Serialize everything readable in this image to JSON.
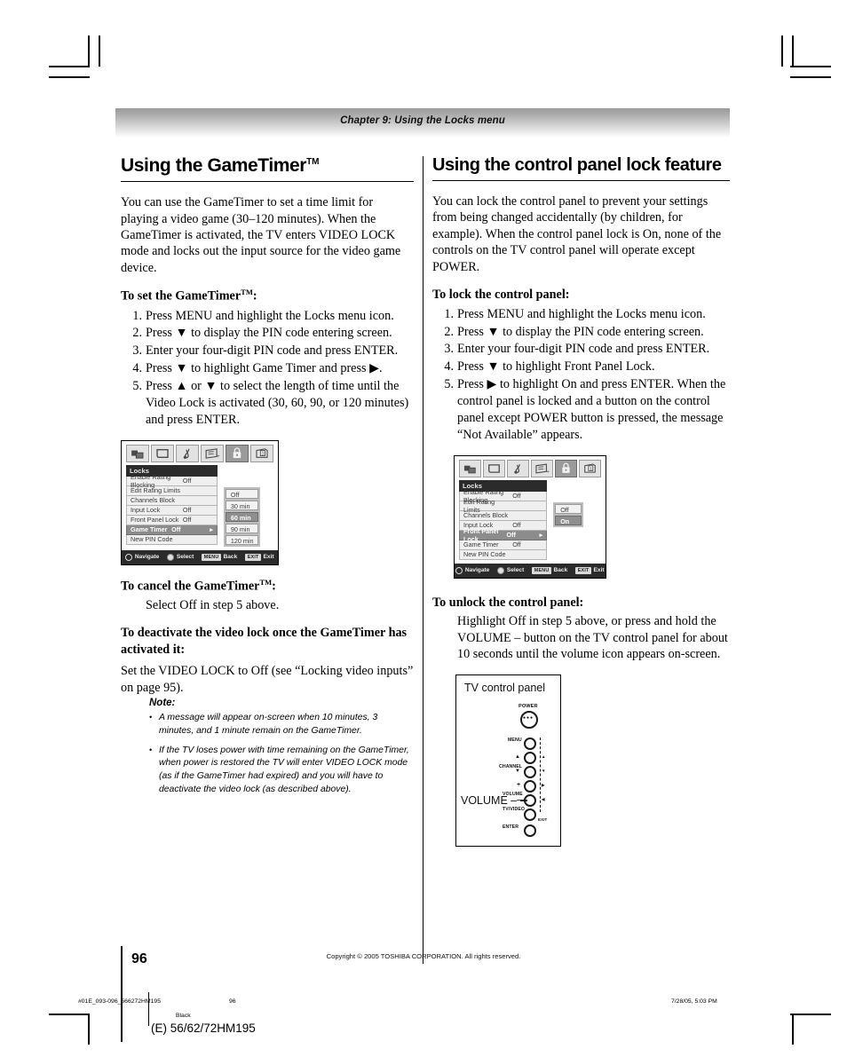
{
  "chapter": {
    "header": "Chapter 9: Using the Locks menu"
  },
  "left_column": {
    "heading": "Using the GameTimer",
    "heading_tm": "TM",
    "intro": "You can use the GameTimer to set a time limit for playing a video game (30–120 minutes). When the GameTimer is activated, the TV enters VIDEO LOCK mode and locks out the input source for the video game device.",
    "set_heading": "To set the GameTimer",
    "set_heading_tm": "TM",
    "set_heading_colon": ":",
    "steps": [
      "Press MENU and highlight the Locks menu icon.",
      "Press ▼ to display the PIN code entering screen.",
      "Enter your four-digit PIN code and press ENTER.",
      "Press ▼ to highlight Game Timer and press ▶.",
      "Press ▲ or ▼ to select the length of time until the Video Lock is activated (30, 60, 90, or 120 minutes) and press ENTER."
    ],
    "cancel_heading": "To cancel the GameTimer",
    "cancel_heading_tm": "TM",
    "cancel_heading_colon": ":",
    "cancel_text": "Select Off in step 5 above.",
    "deactivate_heading": "To deactivate the video lock once the GameTimer has activated it:",
    "deactivate_text": "Set the VIDEO LOCK to Off (see “Locking video inputs” on page 95).",
    "note_label": "Note:",
    "notes": [
      "A message will appear on-screen when 10 minutes, 3 minutes, and 1 minute remain on the GameTimer.",
      "If the TV loses power with time remaining on the GameTimer, when power is restored the TV will enter VIDEO LOCK mode (as if the GameTimer had expired) and you will have to deactivate the video lock (as described above)."
    ]
  },
  "right_column": {
    "heading": "Using the control panel lock feature",
    "intro": "You can lock the control panel to prevent your settings from being changed accidentally (by children, for example). When the control panel lock is On, none of the controls on the TV control panel will operate except POWER.",
    "lock_heading": "To lock the control panel:",
    "steps": [
      "Press MENU and highlight the Locks menu icon.",
      "Press ▼ to display the PIN code entering screen.",
      "Enter your four-digit PIN code and press ENTER.",
      "Press ▼ to highlight Front Panel Lock.",
      "Press ▶ to highlight On and press ENTER. When the control panel is locked and a button on the control panel except POWER button is pressed, the message “Not Available” appears."
    ],
    "unlock_heading": "To unlock the control panel:",
    "unlock_text": "Highlight Off in step 5 above, or press and hold the VOLUME – button on the TV control panel for about 10 seconds until the volume icon appears on-screen."
  },
  "osd_left": {
    "icons": [
      "picture-icon",
      "video-icon",
      "audio-icon",
      "settings-icon",
      "locks-icon",
      "setup-icon"
    ],
    "active_icon_index": 4,
    "title": "Locks",
    "rows": [
      {
        "label": "Enable Rating Blocking",
        "value": "Off",
        "selected": false,
        "arrow": ""
      },
      {
        "label": "Edit Rating Limits",
        "value": "",
        "selected": false,
        "arrow": ""
      },
      {
        "label": "Channels Block",
        "value": "",
        "selected": false,
        "arrow": ""
      },
      {
        "label": "Input Lock",
        "value": "Off",
        "selected": false,
        "arrow": ""
      },
      {
        "label": "Front Panel Lock",
        "value": "Off",
        "selected": false,
        "arrow": ""
      },
      {
        "label": "Game Timer",
        "value": "Off",
        "selected": true,
        "arrow": "▸"
      },
      {
        "label": "New PIN Code",
        "value": "",
        "selected": false,
        "arrow": ""
      }
    ],
    "dropdown": [
      {
        "label": "Off",
        "selected": false
      },
      {
        "label": "30 min",
        "selected": false
      },
      {
        "label": "60 min",
        "selected": true
      },
      {
        "label": "90 min",
        "selected": false
      },
      {
        "label": "120 min",
        "selected": false
      }
    ],
    "navbar": [
      {
        "glyph": "ring",
        "label": "Navigate"
      },
      {
        "glyph": "dot",
        "label": "Select"
      },
      {
        "glyph": "key",
        "key": "MENU",
        "label": "Back"
      },
      {
        "glyph": "key",
        "key": "EXIT",
        "label": "Exit"
      }
    ]
  },
  "osd_right": {
    "icons": [
      "picture-icon",
      "video-icon",
      "audio-icon",
      "settings-icon",
      "locks-icon",
      "setup-icon"
    ],
    "active_icon_index": 4,
    "title": "Locks",
    "rows": [
      {
        "label": "Enable Rating Blocking",
        "value": "Off",
        "selected": false,
        "arrow": ""
      },
      {
        "label": "Edit Rating Limits",
        "value": "",
        "selected": false,
        "arrow": ""
      },
      {
        "label": "Channels Block",
        "value": "",
        "selected": false,
        "arrow": ""
      },
      {
        "label": "Input Lock",
        "value": "Off",
        "selected": false,
        "arrow": ""
      },
      {
        "label": "Front Panel Lock",
        "value": "Off",
        "selected": true,
        "arrow": "▸"
      },
      {
        "label": "Game Timer",
        "value": "Off",
        "selected": false,
        "arrow": ""
      },
      {
        "label": "New PIN Code",
        "value": "",
        "selected": false,
        "arrow": ""
      }
    ],
    "dropdown": [
      {
        "label": "Off",
        "selected": false
      },
      {
        "label": "On",
        "selected": true
      }
    ],
    "navbar": [
      {
        "glyph": "ring",
        "label": "Navigate"
      },
      {
        "glyph": "dot",
        "label": "Select"
      },
      {
        "glyph": "key",
        "key": "MENU",
        "label": "Back"
      },
      {
        "glyph": "key",
        "key": "EXIT",
        "label": "Exit"
      }
    ]
  },
  "tv_panel": {
    "title": "TV control panel",
    "power_label": "POWER",
    "power_dots": "●●●",
    "volume_callout": "VOLUME –",
    "buttons": [
      {
        "label": "MENU",
        "side_glyph": ""
      },
      {
        "label": "CHANNEL",
        "side_glyph": "▲"
      },
      {
        "label": "",
        "side_glyph": "▼"
      },
      {
        "label": "+",
        "side_glyph": "▶"
      },
      {
        "label": "VOLUME",
        "side_glyph": ""
      },
      {
        "label": "–",
        "side_glyph": "◀"
      },
      {
        "label": "TV/VIDEO",
        "side_glyph": "EXIT"
      },
      {
        "label": "ENTER",
        "side_glyph": ""
      }
    ]
  },
  "footer": {
    "page_number": "96",
    "copyright": "Copyright © 2005 TOSHIBA CORPORATION. All rights reserved.",
    "file_name": "#01E_093-096_566272HM195",
    "file_page": "96",
    "date": "7/28/05, 5:03 PM",
    "color_note": "Black",
    "model": "(E) 56/62/72HM195"
  }
}
